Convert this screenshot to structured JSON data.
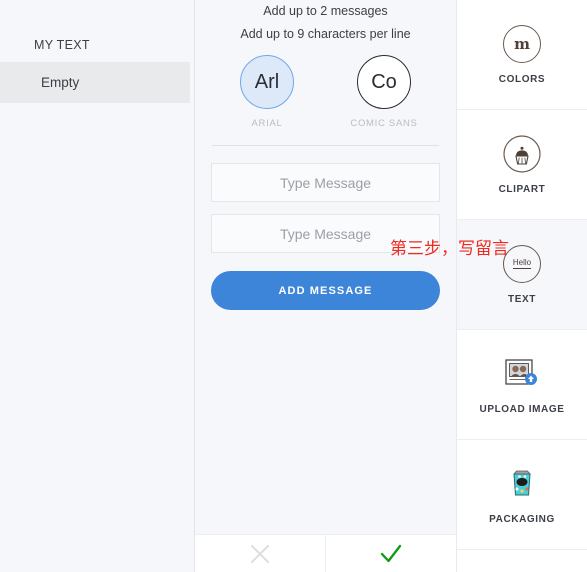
{
  "left_panel": {
    "heading": "MY TEXT",
    "row_label": "Empty"
  },
  "center_panel": {
    "hint_1": "Add up to 2 messages",
    "hint_2": "Add up to 9 characters per line",
    "fonts": [
      {
        "sample": "Arl",
        "label": "ARIAL",
        "selected": true
      },
      {
        "sample": "Co",
        "label": "COMIC SANS",
        "selected": false
      }
    ],
    "inputs": [
      {
        "value": "",
        "placeholder": "Type Message"
      },
      {
        "value": "",
        "placeholder": "Type Message"
      }
    ],
    "add_button_label": "ADD MESSAGE"
  },
  "annotation": {
    "text": "第三步，写留言",
    "color": "#ef2a21"
  },
  "bottom_bar": {
    "cancel_icon": "close-x-icon",
    "confirm_icon": "check-icon",
    "cancel_color": "#dcdee2",
    "confirm_color": "#119a11"
  },
  "right_panel": {
    "tools": [
      {
        "label": "COLORS",
        "icon": "mm-logo-icon",
        "glyph": "m",
        "active": false
      },
      {
        "label": "CLIPART",
        "icon": "cupcake-icon",
        "glyph": "",
        "active": false
      },
      {
        "label": "TEXT",
        "icon": "hello-text-icon",
        "glyph": "Hello",
        "active": true
      },
      {
        "label": "UPLOAD IMAGE",
        "icon": "upload-photo-icon",
        "glyph": "",
        "active": false
      },
      {
        "label": "PACKAGING",
        "icon": "candy-bag-icon",
        "glyph": "",
        "active": false
      }
    ]
  },
  "theme": {
    "accent": "#3d85d8",
    "page_bg": "#f6f7fb",
    "selected_font_bg": "#dde9f8"
  }
}
